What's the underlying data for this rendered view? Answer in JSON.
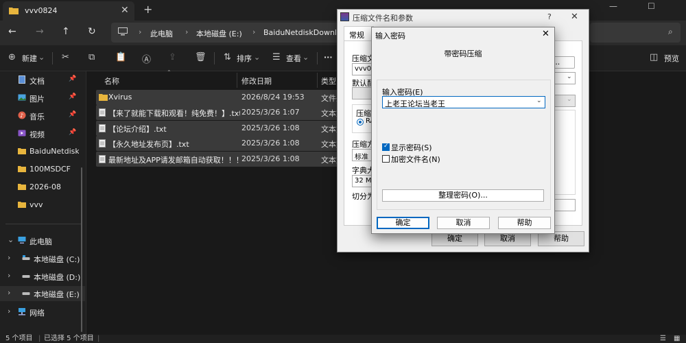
{
  "explorer": {
    "tab_title": "vvv0824",
    "new_tab_label": "+",
    "breadcrumbs": [
      "此电脑",
      "本地磁盘 (E:)",
      "BaiduNetdiskDownloa"
    ],
    "toolbar": {
      "new_label": "新建",
      "sort_label": "排序",
      "view_label": "查看",
      "more_label": "···",
      "preview_label": "预览"
    },
    "sidebar": {
      "quick": [
        {
          "label": "文档",
          "icon": "document-icon"
        },
        {
          "label": "图片",
          "icon": "picture-icon"
        },
        {
          "label": "音乐",
          "icon": "music-icon"
        },
        {
          "label": "视频",
          "icon": "video-icon"
        },
        {
          "label": "BaiduNetdiskD",
          "icon": "folder-icon"
        },
        {
          "label": "100MSDCF",
          "icon": "folder-icon"
        },
        {
          "label": "2026-08",
          "icon": "folder-icon"
        },
        {
          "label": "vvv",
          "icon": "folder-icon"
        }
      ],
      "this_pc": "此电脑",
      "drives": [
        "本地磁盘 (C:)",
        "本地磁盘 (D:)",
        "本地磁盘 (E:)"
      ],
      "network": "网络"
    },
    "columns": {
      "name": "名称",
      "modified": "修改日期",
      "type": "类型"
    },
    "files": [
      {
        "name": "Xvirus",
        "date": "2026/8/24 19:53",
        "type": "文件夹",
        "kind": "folder"
      },
      {
        "name": "【来了就能下载和观看！纯免费！】.txt",
        "date": "2025/3/26 1:07",
        "type": "文本文",
        "kind": "txt"
      },
      {
        "name": "【论坛介绍】.txt",
        "date": "2025/3/26 1:08",
        "type": "文本文",
        "kind": "txt"
      },
      {
        "name": "【永久地址发布页】.txt",
        "date": "2025/3/26 1:08",
        "type": "文本文",
        "kind": "txt"
      },
      {
        "name": "最新地址及APP请发邮箱自动获取！！！....",
        "date": "2025/3/26 1:08",
        "type": "文本文",
        "kind": "txt"
      }
    ],
    "status": {
      "count": "5 个项目",
      "selected": "已选择 5 个项目"
    }
  },
  "archive_dialog": {
    "title": "压缩文件名和参数",
    "help_mark": "?",
    "tab_general": "常规",
    "label_archive_name": "压缩文",
    "archive_name_value": "vvv082",
    "browse_label": "(B)...",
    "label_default": "默认配",
    "label_format": "压缩文",
    "format_value": "RA",
    "label_method": "压缩方",
    "method_value": "标准",
    "label_dict": "字典大",
    "dict_value": "32 MB",
    "label_split": "切分为",
    "ok": "确定",
    "cancel": "取消",
    "help": "帮助"
  },
  "password_dialog": {
    "title": "输入密码",
    "heading": "带密码压缩",
    "password_label": "输入密码(E)",
    "password_value": "上老王论坛当老王",
    "show_password": "显示密码(S)",
    "show_password_checked": true,
    "encrypt_names": "加密文件名(N)",
    "encrypt_names_checked": false,
    "organize_label": "整理密码(O)...",
    "ok": "确定",
    "cancel": "取消",
    "help": "帮助"
  },
  "colors": {
    "accent": "#0067c0",
    "folder": "#e8b53d",
    "selected_row": "#3a3a3a"
  }
}
